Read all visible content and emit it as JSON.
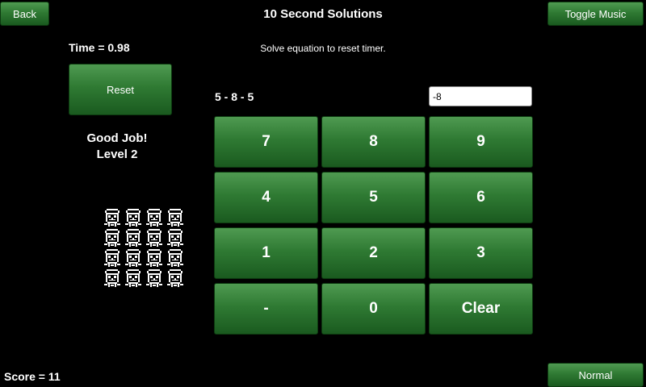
{
  "header": {
    "back_label": "Back",
    "title": "10 Second Solutions",
    "music_label": "Toggle Music"
  },
  "timer": {
    "text": "Time = 0.98"
  },
  "instruction": "Solve equation to reset timer.",
  "reset_label": "Reset",
  "equation": "5 - 8 - 5",
  "answer_value": "-8",
  "feedback": {
    "line1": "Good Job!",
    "line2": "Level 2"
  },
  "keypad": [
    "7",
    "8",
    "9",
    "4",
    "5",
    "6",
    "1",
    "2",
    "3",
    "-",
    "0",
    "Clear"
  ],
  "lives": {
    "count": 16,
    "icon": "face-icon"
  },
  "score": {
    "text": "Score = 11"
  },
  "difficulty_label": "Normal",
  "colors": {
    "button_green": "#2f7a33",
    "background": "#000000"
  }
}
